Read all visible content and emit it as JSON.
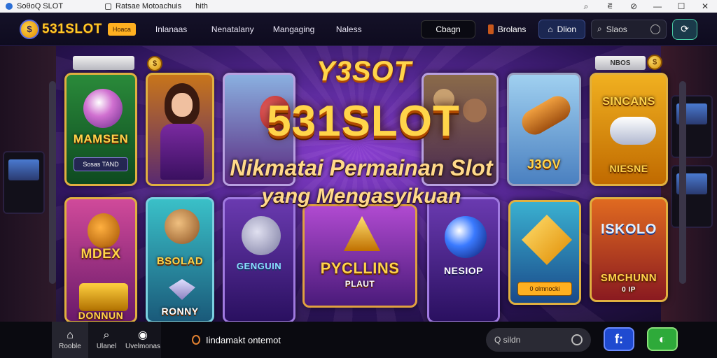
{
  "titlebar": {
    "app_name": "SoθoQ SLOT",
    "tab_label": "Ratsae Motoachuis",
    "tab_extra": "hith",
    "controls": [
      "⌕",
      "⋷",
      "⊘",
      "—",
      "☐",
      "✕"
    ]
  },
  "navbar": {
    "brand": "531SLOT",
    "brand_badge": "Hoaca",
    "links": [
      "Inlanaas",
      "Nenatalany",
      "Mangaging",
      "Naless"
    ],
    "btn_dark": "Cbagn",
    "btn_plain": "Brolans",
    "btn_blue": "Dlion",
    "search_label": "Slaos",
    "round_icon": "⟳"
  },
  "hero": {
    "small_logo": "Y3SOT",
    "title": "531SLOT",
    "subtitle_line1": "Nikmatai Permainan Slot",
    "subtitle_line2": "yang Mengasyikuan"
  },
  "cards": [
    {
      "name": "MAMSEN",
      "sub": "Sosas TAND",
      "ribbon": "",
      "theme": "green"
    },
    {
      "name": "",
      "sub": "",
      "theme": "hero-woman"
    },
    {
      "name": "",
      "sub": "",
      "theme": "fruit"
    },
    {
      "name": "",
      "sub": "",
      "theme": "warrior"
    },
    {
      "name": "J3OV",
      "sub": "",
      "theme": "rocket"
    },
    {
      "name": "SINCANS",
      "sub": "NIESNE",
      "ribbon": "NBOS",
      "theme": "yellow"
    },
    {
      "name": "MDEX",
      "sub": "DONNUN",
      "theme": "pink"
    },
    {
      "name": "BSOLAD",
      "sub": "RONNY",
      "theme": "cyan"
    },
    {
      "name": "GENGUIN",
      "sub": "",
      "theme": "purple"
    },
    {
      "name": "PYCLLINS",
      "sub": "PLAUT",
      "theme": "gold"
    },
    {
      "name": "NESIOP",
      "sub": "",
      "theme": "orb"
    },
    {
      "name": "",
      "sub": "0 olmnocki",
      "theme": "diamond"
    },
    {
      "name": "ISKOLO",
      "sub": "SMCHUNN",
      "sub2": "0 IP",
      "theme": "orange"
    }
  ],
  "ribbons": {
    "left": "",
    "right": "NBOS"
  },
  "bottom": {
    "nav": [
      {
        "icon": "⌂",
        "label": "Rooble"
      },
      {
        "icon": "⌕",
        "label": "Ulanel"
      },
      {
        "icon": "◉",
        "label": "Uvelmonas"
      }
    ],
    "ticker": "Iindamakt ontemot",
    "search_label": "Q sildn",
    "blue_icon": "f:",
    "green_icon": "◐"
  }
}
